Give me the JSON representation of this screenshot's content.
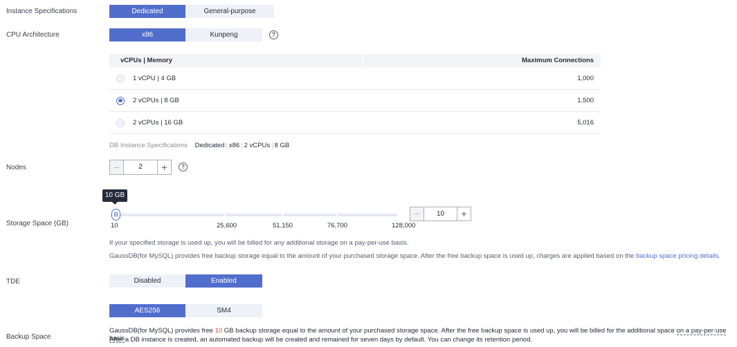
{
  "instance_specs": {
    "label": "Instance Specifications",
    "options": [
      "Dedicated",
      "General-purpose"
    ],
    "selected": "Dedicated"
  },
  "cpu_arch": {
    "label": "CPU Architecture",
    "options": [
      "x86",
      "Kunpeng"
    ],
    "selected": "x86",
    "help_icon": "question-circle-icon"
  },
  "spec_table": {
    "col_spec": "vCPUs | Memory",
    "col_conn": "Maximum Connections",
    "rows": [
      {
        "spec": "1 vCPU | 4 GB",
        "conn": "1,000",
        "selected": false
      },
      {
        "spec": "2 vCPUs | 8 GB",
        "conn": "1,500",
        "selected": true
      },
      {
        "spec": "2 vCPUs | 16 GB",
        "conn": "5,016",
        "selected": false
      }
    ]
  },
  "summary": {
    "label": "DB Instance Specifications",
    "values": [
      "Dedicated",
      "x86",
      "2 vCPUs",
      "8 GB"
    ],
    "separator": "|"
  },
  "nodes": {
    "label": "Nodes",
    "value": "2",
    "minus": "−",
    "plus": "+"
  },
  "storage": {
    "label": "Storage Space (GB)",
    "tooltip": "10 GB",
    "value": "10",
    "ticks": [
      "10",
      "25,600",
      "51,150",
      "76,700",
      "128,000"
    ],
    "thumb_glyph": "|||",
    "minus": "−",
    "plus": "+",
    "note1": "If your specified storage is used up, you will be billed for any additional storage on a pay-per-use basis.",
    "note2_text": "GaussDB(for MySQL) provides free backup storage equal to the amount of your purchased storage space. After the free backup space is used up, charges are applied based on the ",
    "note2_link": "backup space pricing details",
    "note2_end": "."
  },
  "tde": {
    "label": "TDE",
    "options": [
      "Disabled",
      "Enabled"
    ],
    "selected": "Enabled"
  },
  "algorithm": {
    "options": [
      "AES256",
      "SM4"
    ],
    "selected": "AES256"
  },
  "backup": {
    "label": "Backup Space",
    "line1_a": "GaussDB(for MySQL) provides free ",
    "line1_num": "10",
    "line1_b": " GB backup storage equal to the amount of your purchased storage space. After the free backup space is used up, you will be billed for the additional space ",
    "line1_link": "on a pay-per-use basis",
    "line1_end": ".",
    "line2": "After a DB instance is created, an automated backup will be created and remained for seven days by default. You can change its retention period."
  },
  "colors": {
    "accent": "#526ecc",
    "unselected_bg": "#eef1f8",
    "highlight": "#e33f33"
  }
}
